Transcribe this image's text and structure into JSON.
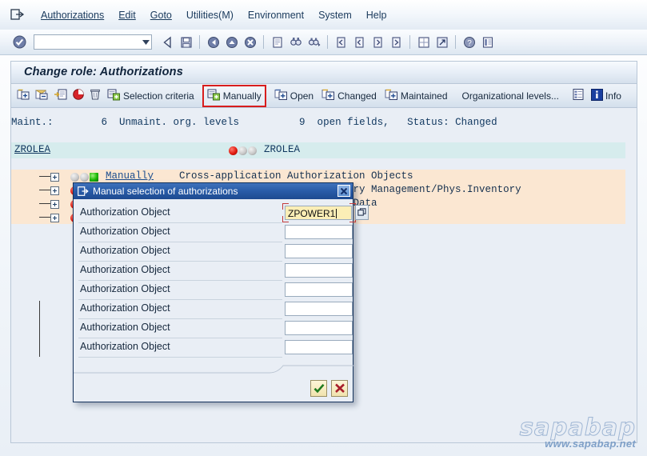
{
  "window": {
    "system_icon": "sap-logoff-icon"
  },
  "menu": {
    "items": [
      {
        "label": "Authorizations",
        "accel": "A"
      },
      {
        "label": "Edit",
        "accel": "E"
      },
      {
        "label": "Goto",
        "accel": "G"
      },
      {
        "label": "Utilities(M)",
        "accel": "M"
      },
      {
        "label": "Environment",
        "accel": "n"
      },
      {
        "label": "System",
        "accel": "y"
      },
      {
        "label": "Help",
        "accel": "H"
      }
    ]
  },
  "toolbar": {
    "command_field_value": "",
    "command_field_placeholder": "",
    "buttons": [
      {
        "name": "enter-ok-icon",
        "glyph": "check-circle"
      },
      {
        "name": "back-icon",
        "glyph": "back-arrow"
      },
      {
        "name": "save-icon",
        "glyph": "floppy-disk"
      },
      {
        "name": "exit-icon",
        "glyph": "green-back"
      },
      {
        "name": "cancel-icon",
        "glyph": "yellow-up"
      },
      {
        "name": "stop-icon",
        "glyph": "red-x-circle"
      },
      {
        "name": "print-icon",
        "glyph": "printer"
      },
      {
        "name": "find-icon",
        "glyph": "binoculars"
      },
      {
        "name": "find-next-icon",
        "glyph": "binoculars-plus"
      },
      {
        "name": "first-page-icon",
        "glyph": "page-first"
      },
      {
        "name": "previous-page-icon",
        "glyph": "page-prev"
      },
      {
        "name": "next-page-icon",
        "glyph": "page-next"
      },
      {
        "name": "last-page-icon",
        "glyph": "page-last"
      },
      {
        "name": "create-session-icon",
        "glyph": "grid"
      },
      {
        "name": "create-shortcut-icon",
        "glyph": "shortcut"
      },
      {
        "name": "help-icon",
        "glyph": "question-circle"
      },
      {
        "name": "layout-menu-icon",
        "glyph": "customize"
      }
    ]
  },
  "title": {
    "text": "Change role: Authorizations"
  },
  "app_toolbar": {
    "buttons": [
      {
        "label": "",
        "icon": "expand-all-icon",
        "name": "expand-subtree-button",
        "highlight": false
      },
      {
        "label": "",
        "icon": "collapse-all-icon",
        "name": "collapse-subtree-button",
        "highlight": false
      },
      {
        "label": "",
        "icon": "authorization-copy-icon",
        "name": "copy-authorization-button",
        "highlight": false
      },
      {
        "label": "",
        "icon": "deactivate-icon",
        "name": "deactivate-button",
        "highlight": false
      },
      {
        "label": "",
        "icon": "trash-icon",
        "name": "delete-button",
        "highlight": false
      },
      {
        "label": "Selection criteria",
        "icon": "selection-criteria-icon",
        "name": "selection-criteria-button",
        "highlight": false
      },
      {
        "label": "Manually",
        "icon": "manually-icon",
        "name": "manually-button",
        "highlight": true
      },
      {
        "label": "Open",
        "icon": "open-icon",
        "name": "open-button",
        "highlight": false
      },
      {
        "label": "Changed",
        "icon": "changed-icon",
        "name": "changed-button",
        "highlight": false
      },
      {
        "label": "Maintained",
        "icon": "maintained-icon",
        "name": "maintained-button",
        "highlight": false
      },
      {
        "label": "Organizational levels...",
        "icon": "",
        "name": "organizational-levels-button",
        "highlight": false
      },
      {
        "label": "",
        "icon": "list-icon",
        "name": "list-button",
        "highlight": false
      },
      {
        "label": "Info",
        "icon": "info-icon",
        "name": "info-button",
        "highlight": false
      }
    ]
  },
  "status_line": {
    "text": "Maint.:        6  Unmaint. org. levels          9  open fields,   Status: Changed",
    "maint_label": "Maint.:",
    "maint_value": "6",
    "unmaint_label": "Unmaint. org. levels",
    "open_fields_value": "9",
    "open_fields_label": "open fields,",
    "status_label": "Status:",
    "status_value": "Changed"
  },
  "tree": {
    "header": {
      "name": "ZROLEA",
      "lights": [
        "red",
        "grey",
        "grey"
      ],
      "role": "ZROLEA"
    },
    "rows": [
      {
        "lights": [
          "grey",
          "grey",
          "green"
        ],
        "object": "Manually",
        "text": "Cross-application Authorization Objects"
      },
      {
        "lights": [
          "red",
          "grey",
          "grey"
        ],
        "object": "",
        "text": "Materials Management: Inventory Management/Phys.Inventory"
      },
      {
        "lights": [
          "red",
          "grey",
          "grey"
        ],
        "object": "",
        "text": "Materials Management: Master Data"
      },
      {
        "lights": [
          "red",
          "grey",
          "grey"
        ],
        "object": "",
        "text": ""
      }
    ]
  },
  "dialog": {
    "title": "Manual selection of authorizations",
    "title_icon": "sap-dialog-icon",
    "close_label": "✖",
    "rows": [
      {
        "label": "Authorization Object",
        "value": "ZPOWER1",
        "focused": true
      },
      {
        "label": "Authorization Object",
        "value": "",
        "focused": false
      },
      {
        "label": "Authorization Object",
        "value": "",
        "focused": false
      },
      {
        "label": "Authorization Object",
        "value": "",
        "focused": false
      },
      {
        "label": "Authorization Object",
        "value": "",
        "focused": false
      },
      {
        "label": "Authorization Object",
        "value": "",
        "focused": false
      },
      {
        "label": "Authorization Object",
        "value": "",
        "focused": false
      },
      {
        "label": "Authorization Object",
        "value": "",
        "focused": false
      }
    ],
    "confirm_button": {
      "name": "confirm-button",
      "glyph": "green-check"
    },
    "cancel_button": {
      "name": "cancel-button",
      "glyph": "red-cross"
    },
    "search_help_icon": "search-help-icon"
  },
  "watermark": {
    "main": "sapabap",
    "sub": "www.sapabap.net"
  },
  "colors": {
    "accent_blue": "#1d4a90",
    "highlight_red": "#d81d1d",
    "tree_row_bg": "#fbe7d2",
    "tree_header_bg": "#d6eced",
    "focus_field_bg": "#fbeeb6",
    "panel_bg": "#e9eef5"
  }
}
